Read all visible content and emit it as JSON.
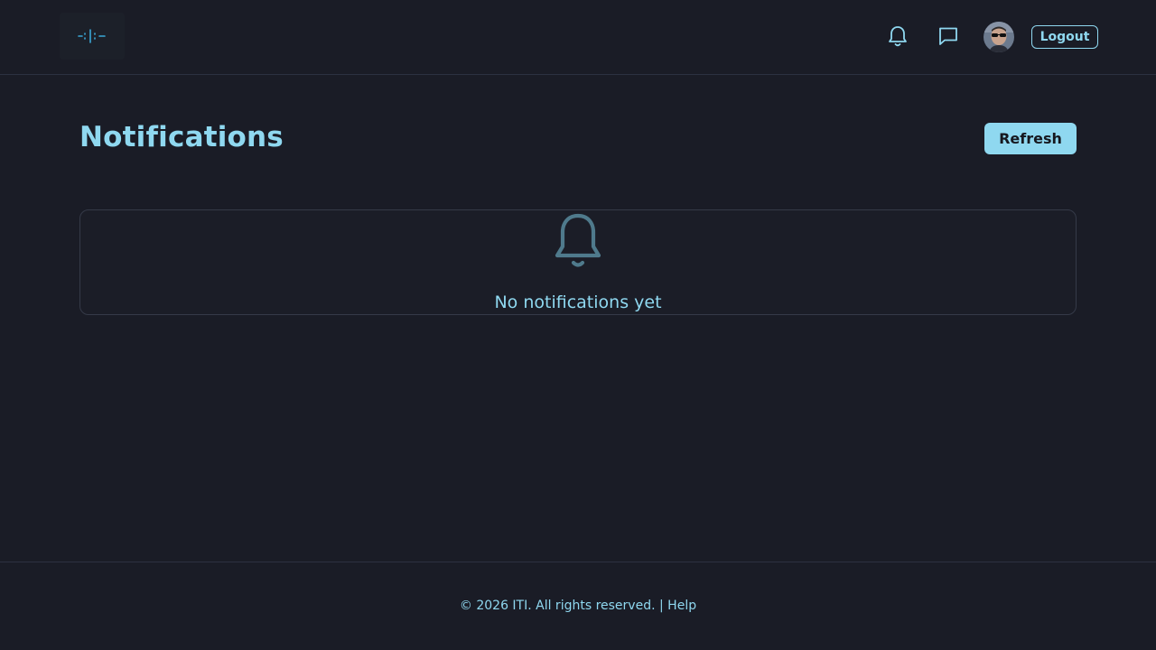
{
  "header": {
    "logo_icon": "waveform-logo-icon",
    "notifications_icon": "bell-icon",
    "messages_icon": "chat-bubble-icon",
    "avatar_icon": "user-avatar",
    "logout_label": "Logout"
  },
  "main": {
    "title": "Notifications",
    "refresh_label": "Refresh",
    "empty_state": {
      "icon": "bell-icon",
      "message": "No notifications yet"
    }
  },
  "footer": {
    "copyright": "© 2026 ITI. All rights reserved.",
    "separator": "|",
    "help_label": "Help"
  },
  "colors": {
    "background": "#1a1c26",
    "accent": "#8fd8f0",
    "border": "#353a48",
    "muted_icon": "#4f7a8c"
  }
}
